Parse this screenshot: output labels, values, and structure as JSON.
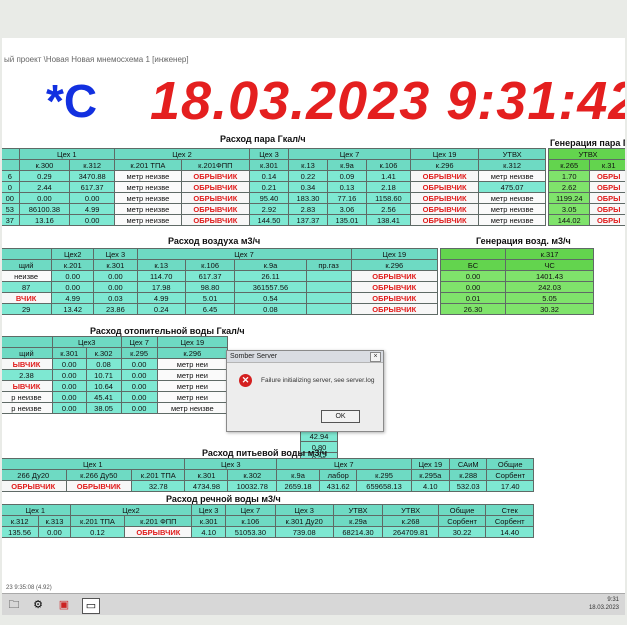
{
  "window": {
    "title": "ый проект \\Новая Новая мнемосхема 1 [инженер]"
  },
  "header": {
    "unit": "*C",
    "datetime": "18.03.2023 9:31:42"
  },
  "sections": {
    "steam": "Расход пара Гкал/ч",
    "steam_gen": "Генерация пара Гкал",
    "air": "Расход воздуха м3/ч",
    "air_gen": "Генерация возд. м3/ч",
    "heating": "Расход отопительной воды Гкал/ч",
    "drinking": "Расход питьевой воды м3/ч",
    "river": "Расход речной воды м3/ч"
  },
  "steam_table": {
    "groups": [
      "Цех 1",
      "Цех 2",
      "Цех 3",
      "Цех 7",
      "Цех 19",
      "УТВХ"
    ],
    "cols": [
      "к.300",
      "к.312",
      "к.201 ТПА",
      "к.201ФПП",
      "к.301",
      "к.13",
      "к.9а",
      "к.106",
      "к.296",
      "к.312"
    ],
    "rows": [
      [
        "6",
        "0.29",
        "3470.88",
        "метр неизве",
        "ОБРЫВЧИК",
        "0.14",
        "0.22",
        "0.09",
        "1.41",
        "ОБРЫВЧИК",
        "метр неизве"
      ],
      [
        "0",
        "2.44",
        "617.37",
        "метр неизве",
        "ОБРЫВЧИК",
        "0.21",
        "0.34",
        "0.13",
        "2.18",
        "ОБРЫВЧИК",
        "475.07"
      ],
      [
        "00",
        "0.00",
        "0.00",
        "метр неизве",
        "ОБРЫВЧИК",
        "95.40",
        "183.30",
        "77.16",
        "1158.60",
        "ОБРЫВЧИК",
        "метр неизве"
      ],
      [
        "53",
        "86100.38",
        "4.99",
        "метр неизве",
        "ОБРЫВЧИК",
        "2.92",
        "2.83",
        "3.06",
        "2.56",
        "ОБРЫВЧИК",
        "метр неизве"
      ],
      [
        "37",
        "13.16",
        "0.00",
        "метр неизве",
        "ОБРЫВЧИК",
        "144.50",
        "137.37",
        "135.01",
        "138.41",
        "ОБРЫВЧИК",
        "метр неизве"
      ]
    ]
  },
  "steam_gen_table": {
    "group": "УТВХ",
    "cols": [
      "к.265",
      "к.31"
    ],
    "rows": [
      [
        "1.70",
        "ОБРЫ"
      ],
      [
        "2.62",
        "ОБРЫ"
      ],
      [
        "1199.24",
        "ОБРЫ"
      ],
      [
        "3.05",
        "ОБРЫ"
      ],
      [
        "144.02",
        "ОБРЫ"
      ]
    ]
  },
  "air_table": {
    "groups": [
      "Цех2",
      "Цех 3",
      "Цех 7",
      "Цех 19"
    ],
    "cols": [
      "щий",
      "к.201",
      "к.301",
      "к.13",
      "к.106",
      "к.9а",
      "пр.газ",
      "к.296"
    ],
    "rows": [
      [
        "неизве",
        "0.00",
        "0.00",
        "114.70",
        "617.37",
        "26.11",
        "",
        "ОБРЫВЧИК"
      ],
      [
        "87",
        "0.00",
        "0.00",
        "17.98",
        "98.80",
        "361557.56",
        "",
        "ОБРЫВЧИК"
      ],
      [
        "ВЧИК",
        "4.99",
        "0.03",
        "4.99",
        "5.01",
        "0.54",
        "",
        "ОБРЫВЧИК"
      ],
      [
        "29",
        "13.42",
        "23.86",
        "0.24",
        "6.45",
        "0.08",
        "",
        "ОБРЫВЧИК"
      ]
    ]
  },
  "air_gen_table": {
    "group": "к.317",
    "cols": [
      "БС",
      "ЧС"
    ],
    "rows": [
      [
        "0.00",
        "1401.43"
      ],
      [
        "0.00",
        "242.03"
      ],
      [
        "0.01",
        "5.05"
      ],
      [
        "26.30",
        "30.32"
      ]
    ]
  },
  "heating_table": {
    "groups": [
      "Цех3",
      "Цех 7",
      "Цех 19"
    ],
    "cols": [
      "щий",
      "к.301",
      "к.302",
      "к.295",
      "к.296"
    ],
    "rows": [
      [
        "ЫВЧИК",
        "0.00",
        "0.08",
        "0.00",
        "метр неи"
      ],
      [
        "2.38",
        "0.00",
        "10.71",
        "0.00",
        "метр неи"
      ],
      [
        "ЫВЧИК",
        "0.00",
        "10.64",
        "0.00",
        "метр неи"
      ],
      [
        "р неизве",
        "0.00",
        "45.41",
        "0.00",
        "метр неи"
      ],
      [
        "р неизве",
        "0.00",
        "38.05",
        "0.00",
        "метр неизве"
      ]
    ],
    "extra": [
      "42.94",
      "0.80",
      "0.36"
    ]
  },
  "drinking_table": {
    "groups": [
      "Цех 1",
      "Цех 3",
      "Цех 7",
      "Цех 19",
      "САиМ",
      "Общие"
    ],
    "cols": [
      "266 Ду20",
      "к.266 Ду50",
      "к.201 ТПА",
      "к.301",
      "к.302",
      "к.9а",
      "лабор",
      "к.295",
      "к.295а",
      "к.288",
      "Сорбент"
    ],
    "rows": [
      [
        "ОБРЫВЧИК",
        "ОБРЫВЧИК",
        "32.78",
        "4734.98",
        "10032.78",
        "2659.18",
        "431.62",
        "659658.13",
        "4.10",
        "532.03",
        "17.40"
      ]
    ]
  },
  "river_table": {
    "groups": [
      "Цех 1",
      "Цех2",
      "Цех 3",
      "Цех 7",
      "Цех 3",
      "УТВХ",
      "УТВХ",
      "Общие",
      "Стек"
    ],
    "cols": [
      "к.312",
      "к.313",
      "к.201 ТПА",
      "к.201 ФПП",
      "к.301",
      "к.106",
      "к.301 Ду20",
      "к.29а",
      "к.268",
      "Сорбент",
      "Сорбент"
    ],
    "rows": [
      [
        "135.56",
        "0.00",
        "0.12",
        "ОБРЫВЧИК",
        "4.10",
        "51053.30",
        "739.08",
        "68214.30",
        "264709.81",
        "30.22",
        "14.40"
      ]
    ]
  },
  "dialog": {
    "title": "Somber Server",
    "close": "×",
    "message": "Failure initializing server, see server.log",
    "ok": "OK"
  },
  "status": {
    "text": "23 9:35:08 (4.92)"
  },
  "taskbar": {
    "icons": [
      "folder-icon",
      "settings-icon",
      "app-icon",
      "terminal-icon"
    ],
    "time": "9:31",
    "date": "18.03.2023"
  }
}
